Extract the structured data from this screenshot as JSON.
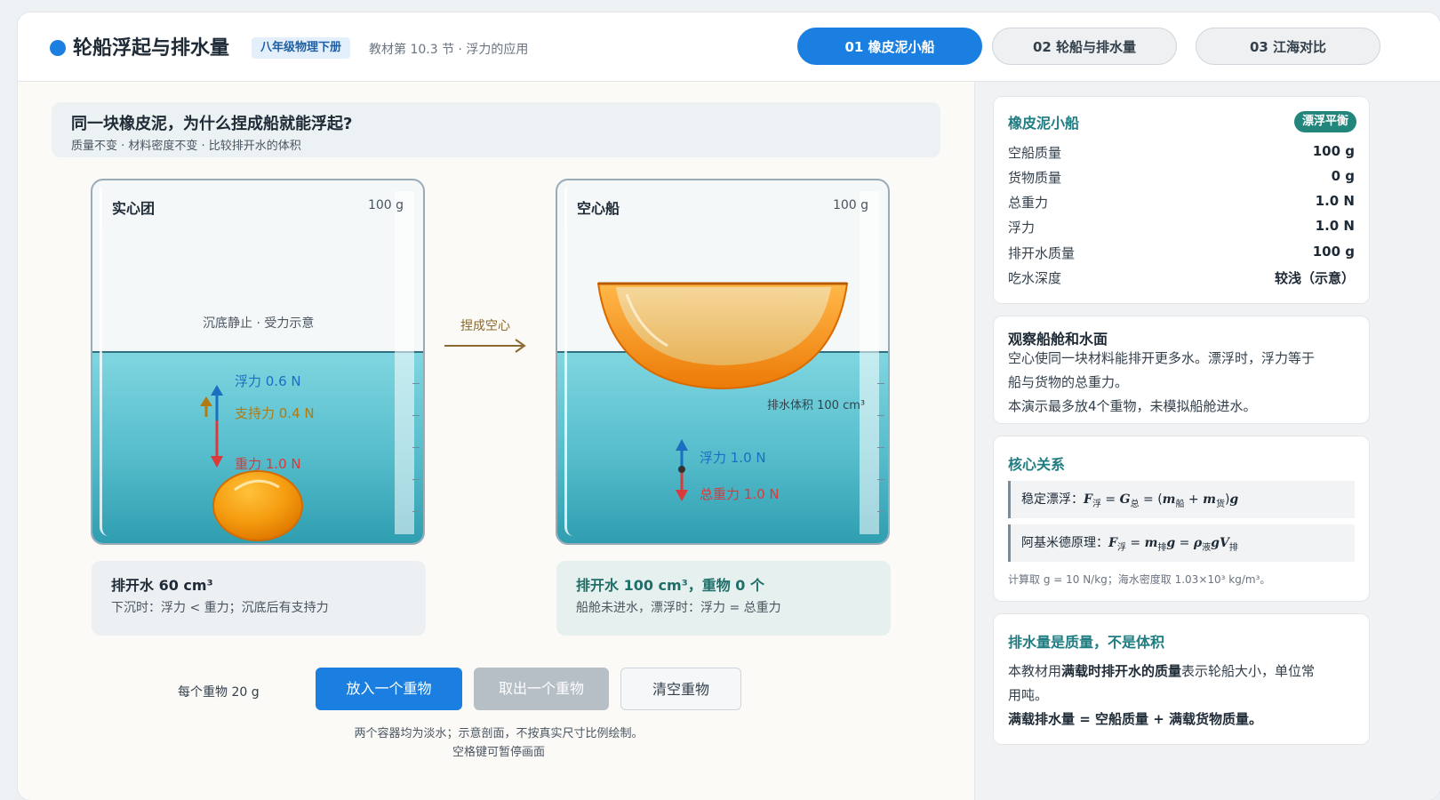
{
  "header": {
    "title": "轮船浮起与排水量",
    "badge": "八年级物理下册",
    "subtitle": "教材第 10.3 节 · 浮力的应用",
    "tabs": [
      "01 橡皮泥小船",
      "02 轮船与排水量",
      "03 江海对比"
    ]
  },
  "question": {
    "title": "同一块橡皮泥，为什么捏成船就能浮起?",
    "subtitle": "质量不变 · 材料密度不变 · 比较排开水的体积"
  },
  "solid": {
    "label": "实心团",
    "mass": "100 g",
    "caption": "沉底静止 · 受力示意",
    "buoyancy": "浮力 0.6 N",
    "support": "支持力 0.4 N",
    "gravity": "重力 1.0 N",
    "result_title": "排开水 60 cm³",
    "result_sub": "下沉时：浮力 < 重力；沉底后有支持力"
  },
  "transition": "捏成空心",
  "boat": {
    "label": "空心船",
    "mass": "100 g",
    "displacement": "排水体积 100 cm³",
    "buoyancy": "浮力 1.0 N",
    "gravity": "总重力 1.0 N",
    "result_title": "排开水 100 cm³，重物 0 个",
    "result_sub": "船舱未进水，漂浮时：浮力 = 总重力"
  },
  "controls": {
    "weight_label": "每个重物 20 g",
    "add": "放入一个重物",
    "remove": "取出一个重物",
    "clear": "清空重物",
    "note1": "两个容器均为淡水；示意剖面，不按真实尺寸比例绘制。",
    "note2": "空格键可暂停画面"
  },
  "stats": {
    "title": "橡皮泥小船",
    "status": "漂浮平衡",
    "rows": [
      {
        "k": "空船质量",
        "v": "100 g"
      },
      {
        "k": "货物质量",
        "v": "0 g"
      },
      {
        "k": "总重力",
        "v": "1.0 N"
      },
      {
        "k": "浮力",
        "v": "1.0 N"
      },
      {
        "k": "排开水质量",
        "v": "100 g"
      },
      {
        "k": "吃水深度",
        "v": "较浅（示意）"
      }
    ]
  },
  "observe": {
    "title": "观察船舱和水面",
    "line1": "空心使同一块材料能排开更多水。漂浮时，浮力等于",
    "line2": "船与货物的总重力。",
    "line3": "本演示最多放4个重物，未模拟船舱进水。"
  },
  "relation": {
    "title": "核心关系",
    "f1_label": "稳定漂浮：",
    "f2_label": "阿基米德原理：",
    "note": "计算取 g = 10 N/kg；海水密度取 1.03×10³ kg/m³。"
  },
  "tonnage": {
    "title": "排水量是质量，不是体积",
    "p1a": "本教材用",
    "p1b": "满载时排开水的质量",
    "p1c": "表示轮船大小，单位常",
    "p2": "用吨。",
    "p3": "满载排水量 = 空船质量 + 满载货物质量。"
  },
  "colors": {
    "accent": "#1a7fe0",
    "buoyancy": "#1a6fc0",
    "support": "#b07a10",
    "gravity": "#d93a3a",
    "teal": "#22867d"
  }
}
